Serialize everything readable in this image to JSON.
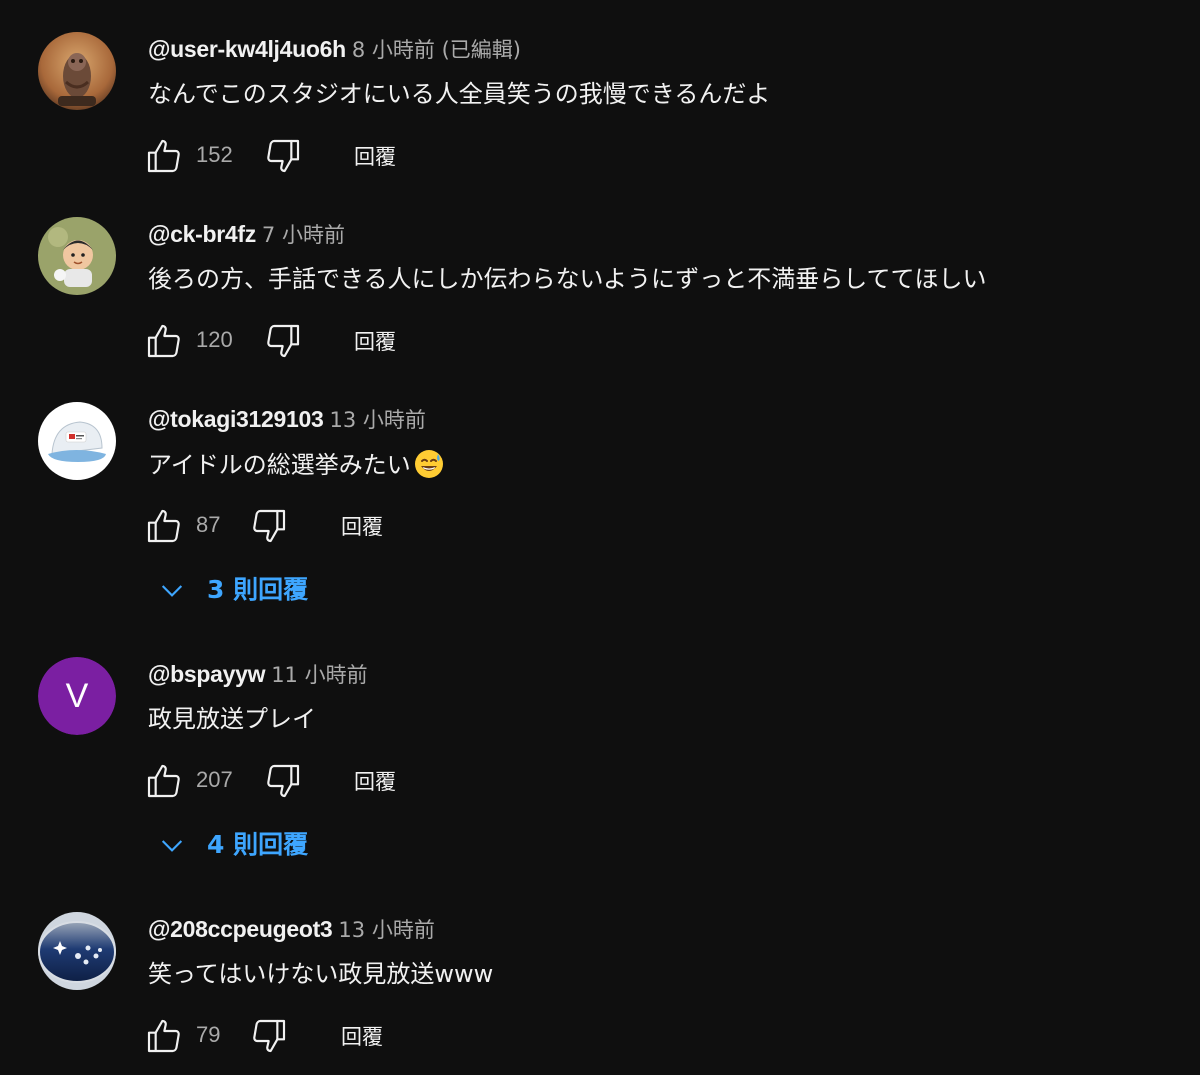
{
  "comments": [
    {
      "author": "@user-kw4lj4uo6h",
      "time": "8 小時前 (已編輯)",
      "text": "なんでこのスタジオにいる人全員笑うの我慢できるんだよ",
      "likes": "152",
      "reply_label": "回覆",
      "avatar_icon": "owl-figure-avatar"
    },
    {
      "author": "@ck-br4fz",
      "time": "7 小時前",
      "text": "後ろの方、手話できる人にしか伝わらないようにずっと不満垂らしててほしい",
      "likes": "120",
      "reply_label": "回覆",
      "avatar_icon": "cartoon-boy-avatar"
    },
    {
      "author": "@tokagi3129103",
      "time": "13 小時前",
      "text": "アイドルの総選挙みたい",
      "emoji": "sweat-smile-emoji",
      "likes": "87",
      "reply_label": "回覆",
      "replies_label": "3 則回覆",
      "avatar_icon": "cap-avatar"
    },
    {
      "author": "@bspayyw",
      "time": "11 小時前",
      "text": "政見放送プレイ",
      "likes": "207",
      "reply_label": "回覆",
      "replies_label": "4 則回覆",
      "avatar_letter": "V",
      "avatar_color": "#7b1fa2"
    },
    {
      "author": "@208ccpeugeot3",
      "time": "13 小時前",
      "text": "笑ってはいけない政見放送www",
      "likes": "79",
      "reply_label": "回覆",
      "avatar_icon": "subaru-emblem-avatar"
    }
  ],
  "colors": {
    "background": "#0f0f0f",
    "text": "#f1f1f1",
    "secondary": "#aaaaaa",
    "link_blue": "#3ea6ff"
  }
}
